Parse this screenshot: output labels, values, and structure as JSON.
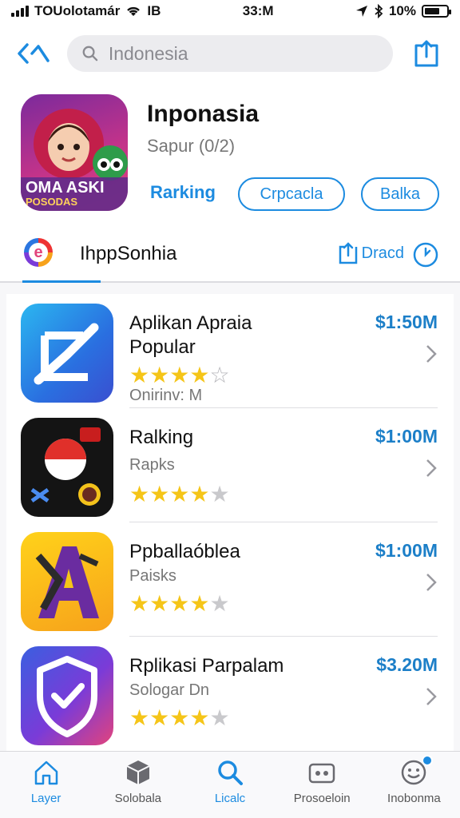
{
  "status_bar": {
    "carrier": "TOUolotamár",
    "network": "IB",
    "time": "33:M",
    "battery_percent": "10%"
  },
  "search": {
    "placeholder": "Indonesia"
  },
  "header": {
    "title": "Inponasia",
    "subtitle": "Sapur (0/2)",
    "icon_text_line1": "OMA ASKI",
    "icon_text_line2": "POSODAS",
    "ranking_label": "Rarking",
    "pill_1_label": "Crpcacla",
    "pill_2_label": "Balka"
  },
  "section": {
    "title": "IhppSonhia",
    "action_label": "Dracd"
  },
  "apps": [
    {
      "title": "Aplikan Apraia",
      "title2": "Popular",
      "subtitle": "Onirinv: M",
      "price": "$1:50M",
      "rating": 4,
      "outline_last": true
    },
    {
      "title": "Ralking",
      "title2": "",
      "subtitle": "Rapks",
      "price": "$1:00M",
      "rating": 4,
      "outline_last": false
    },
    {
      "title": "Ppballaóblea",
      "title2": "",
      "subtitle": "Paisks",
      "price": "$1:00M",
      "rating": 4,
      "outline_last": false
    },
    {
      "title": "Rplikasi Parpalam",
      "title2": "",
      "subtitle": "Sologar Dn",
      "price": "$3.20M",
      "rating": 4,
      "outline_last": false
    }
  ],
  "tabbar": {
    "tabs": [
      {
        "label": "Layer",
        "icon": "house-icon",
        "active": true
      },
      {
        "label": "Solobala",
        "icon": "cube-icon",
        "active": false
      },
      {
        "label": "Licalc",
        "icon": "search-icon",
        "active": true
      },
      {
        "label": "Prosoeloin",
        "icon": "game-controller-icon",
        "active": false
      },
      {
        "label": "Inobonma",
        "icon": "smiley-icon",
        "active": false
      }
    ]
  },
  "colors": {
    "accent": "#1c8be0",
    "price": "#1c7fc8",
    "star": "#f5c518"
  }
}
